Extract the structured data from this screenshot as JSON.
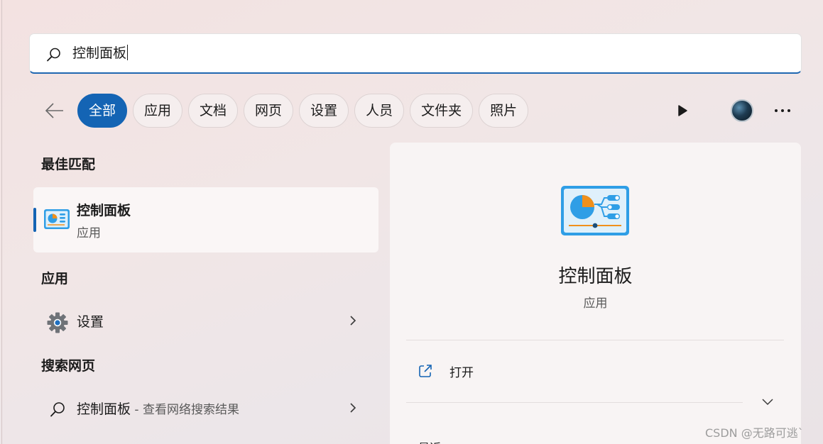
{
  "search": {
    "query": "控制面板"
  },
  "filters": {
    "chips": [
      "全部",
      "应用",
      "文档",
      "网页",
      "设置",
      "人员",
      "文件夹",
      "照片"
    ],
    "active_index": 0
  },
  "sections": {
    "best_match": "最佳匹配",
    "apps": "应用",
    "web": "搜索网页"
  },
  "best_match": {
    "title": "控制面板",
    "subtitle": "应用"
  },
  "apps": [
    {
      "label": "设置",
      "icon": "gear-icon"
    }
  ],
  "web": [
    {
      "label": "控制面板",
      "suffix": " - 查看网络搜索结果",
      "icon": "search-icon"
    }
  ],
  "preview": {
    "title": "控制面板",
    "subtitle": "应用",
    "actions": [
      {
        "label": "打开",
        "icon": "open-external-icon"
      }
    ],
    "recent_label": "最近"
  },
  "watermark": "CSDN @无路可逃`",
  "colors": {
    "accent": "#1464b4",
    "icon_blue": "#2f9ee6",
    "icon_orange": "#f0901c"
  }
}
